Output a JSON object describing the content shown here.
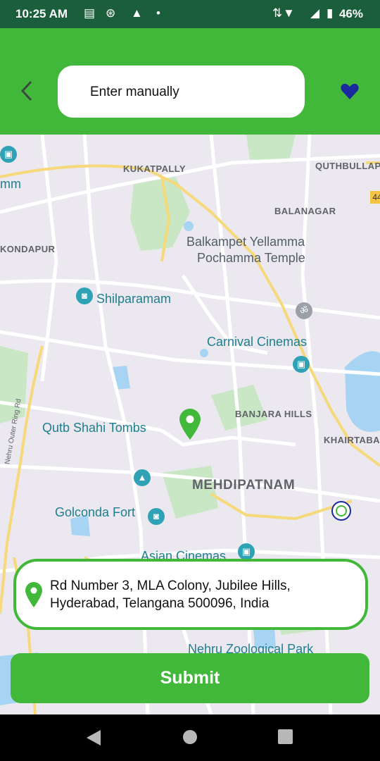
{
  "status_bar": {
    "time": "10:25 AM",
    "battery": "46%",
    "icons": [
      "message-icon",
      "sync-icon",
      "warning-icon",
      "dot-icon",
      "data-arrows-icon",
      "wifi-icon",
      "signal-icon",
      "battery-icon"
    ]
  },
  "header": {
    "search_text": "Enter manually",
    "back_icon": "chevron-left-icon",
    "favorite_icon": "heart-icon",
    "accent_color": "#42b83a",
    "heart_color": "#1a2a9e"
  },
  "map": {
    "areas": {
      "kukatpally": "KUKATPALLY",
      "quthbullapur": "QUTHBULLAPU",
      "balanagar": "BALANAGAR",
      "kondapur": "KONDAPUR",
      "banjara_hills": "BANJARA HILLS",
      "khairtabad": "KHAIRTABAD",
      "mehdipatnam": "MEHDIPATNAM"
    },
    "landmarks": {
      "balkampet_line1": "Balkampet Yellamma",
      "balkampet_line2": "Pochamma Temple",
      "shilparamam": "Shilparamam",
      "carnival": "Carnival Cinemas",
      "qutb": "Qutb Shahi Tombs",
      "golconda": "Golconda Fort",
      "asian": "Asian Cinemas",
      "nehru_zoo": "Nehru Zoological Park",
      "mm": "mm",
      "ring_road": "Nehru Outer Ring Rd",
      "highway": "44"
    }
  },
  "address": {
    "text": "Rd Number 3, MLA Colony, Jubilee Hills, Hyderabad, Telangana 500096, India"
  },
  "submit": {
    "label": "Submit"
  },
  "nav": {
    "back_icon": "triangle-back-icon",
    "home_icon": "circle-home-icon",
    "recents_icon": "square-recents-icon"
  }
}
